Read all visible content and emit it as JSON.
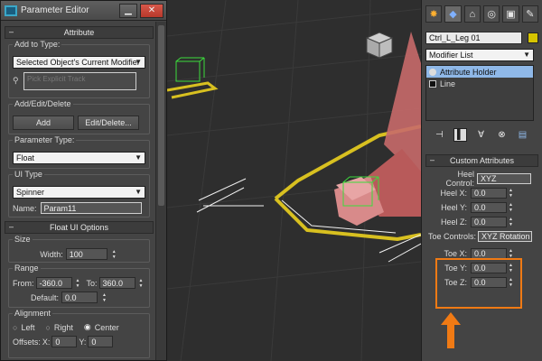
{
  "parameter_editor": {
    "title": "Parameter Editor",
    "close_label": "✕",
    "attribute_rollout": "Attribute",
    "add_to_type_label": "Add to Type:",
    "add_to_type_value": "Selected Object's Current Modifier",
    "pick_track_placeholder": "Pick Explicit Track",
    "add_edit_delete_label": "Add/Edit/Delete",
    "add_button": "Add",
    "edit_delete_button": "Edit/Delete...",
    "parameter_type_label": "Parameter Type:",
    "parameter_type_value": "Float",
    "ui_type_label": "UI Type",
    "ui_type_value": "Spinner",
    "name_label": "Name:",
    "name_value": "Param11",
    "float_ui_rollout": "Float UI Options",
    "size_label": "Size",
    "width_label": "Width:",
    "width_value": "100",
    "range_label": "Range",
    "from_label": "From:",
    "from_value": "-360.0",
    "to_label": "To:",
    "to_value": "360.0",
    "default_label": "Default:",
    "default_value": "0.0",
    "alignment_label": "Alignment",
    "align_left": "Left",
    "align_right": "Right",
    "align_center": "Center",
    "offsets_label": "Offsets:",
    "offset_x_label": "X:",
    "offset_x_value": "0",
    "offset_y_label": "Y:",
    "offset_y_value": "0"
  },
  "command_panel": {
    "object_name": "Ctrl_L_Leg 01",
    "modifier_list": "Modifier List",
    "stack": [
      "Attribute Holder",
      "Line"
    ],
    "custom_attributes_rollout": "Custom Attributes",
    "heel_control_label": "Heel Control:",
    "heel_control_value": "XYZ",
    "heel_x_label": "Heel X:",
    "heel_x_value": "0.0",
    "heel_y_label": "Heel Y:",
    "heel_y_value": "0.0",
    "heel_z_label": "Heel Z:",
    "heel_z_value": "0.0",
    "toe_controls_label": "Toe Controls:",
    "toe_controls_value": "XYZ Rotation",
    "toe_x_label": "Toe X:",
    "toe_x_value": "0.0",
    "toe_y_label": "Toe Y:",
    "toe_y_value": "0.0",
    "toe_z_label": "Toe Z:",
    "toe_z_value": "0.0"
  },
  "colors": {
    "highlight": "#f07a14",
    "object_color": "#d6c400",
    "selection": "#8fb8e8"
  }
}
